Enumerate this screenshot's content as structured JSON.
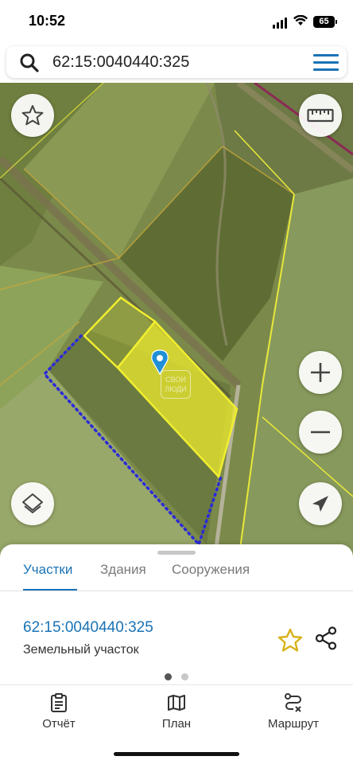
{
  "status_bar": {
    "time": "10:52",
    "battery": "65"
  },
  "search": {
    "query": "62:15:0040440:325",
    "icon": "search-icon",
    "menu_icon": "hamburger-menu-icon"
  },
  "map": {
    "watermark": "СВОИ ЛЮДИ",
    "buttons": {
      "favorites": "star-icon",
      "ruler": "ruler-icon",
      "layers": "layers-icon",
      "zoom_in": "plus-icon",
      "zoom_out": "minus-icon",
      "locate": "navigation-arrow-icon"
    },
    "colors": {
      "selected_parcel": "#f2ef2c",
      "parcel_outline": "#e8e83a",
      "boundary_dotted": "#2b2bd6",
      "pin": "#1f8fd6"
    }
  },
  "sheet": {
    "tabs": [
      {
        "label": "Участки",
        "active": true
      },
      {
        "label": "Здания",
        "active": false
      },
      {
        "label": "Сооружения",
        "active": false
      }
    ],
    "result": {
      "number": "62:15:0040440:325",
      "type": "Земельный участок"
    },
    "pager": {
      "pages": 2,
      "current": 1
    }
  },
  "bottom_nav": [
    {
      "label": "Отчёт",
      "icon": "report-clipboard-icon"
    },
    {
      "label": "План",
      "icon": "map-plan-icon"
    },
    {
      "label": "Маршрут",
      "icon": "route-icon"
    }
  ],
  "accent_color": "#1a73b5"
}
